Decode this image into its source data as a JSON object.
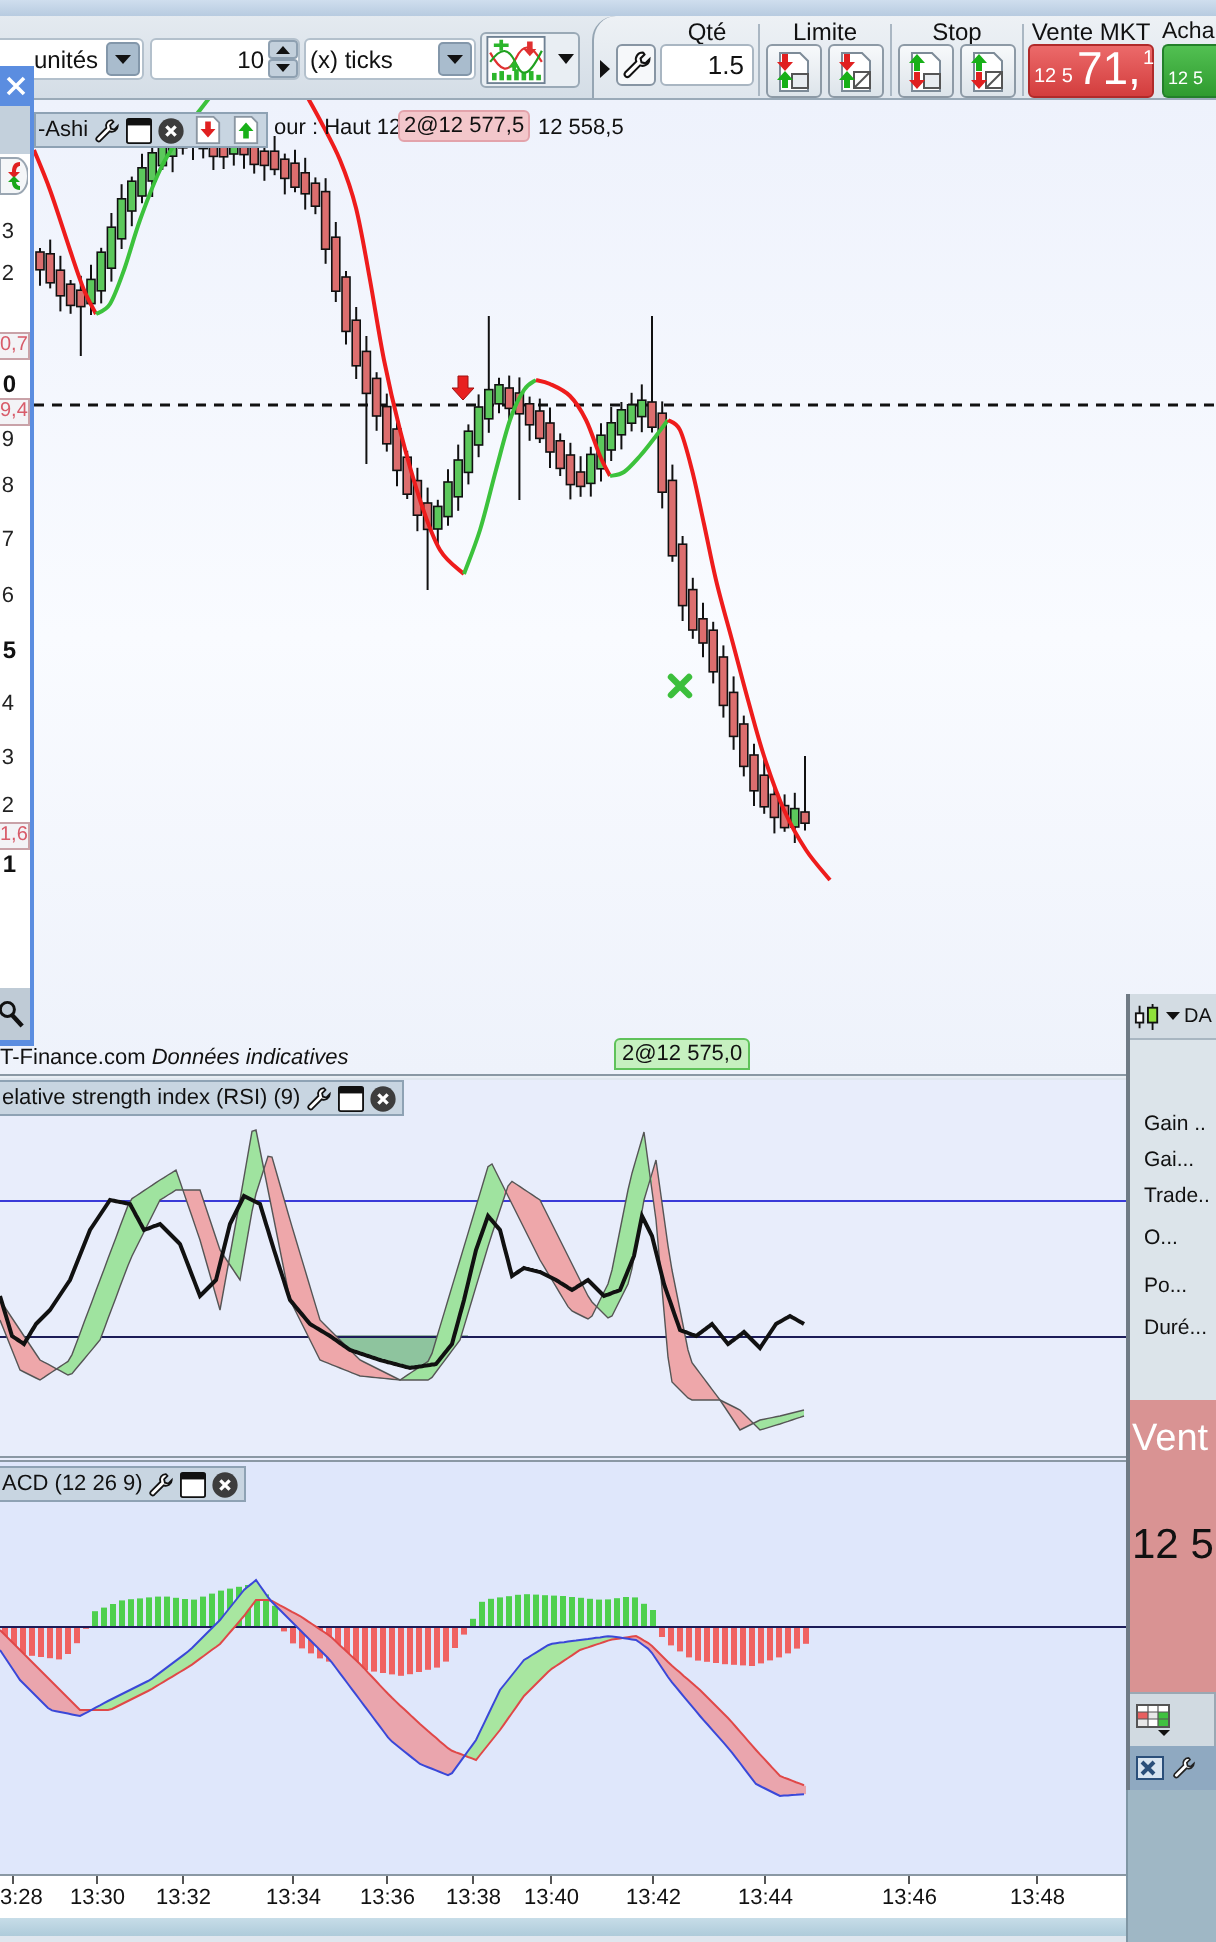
{
  "toolbar": {
    "units_dropdown": {
      "value": "unités"
    },
    "tick_field": {
      "value": "10"
    },
    "tick_unit_dropdown": {
      "value": "(x) ticks"
    },
    "quantity": {
      "label": "Qté",
      "value": "1.5"
    },
    "limit": {
      "label": "Limite"
    },
    "stop": {
      "label": "Stop"
    },
    "sell_market": {
      "label": "Vente MKT",
      "price_prefix": "12 5",
      "price_main": "71,",
      "price_decimal": "1"
    },
    "buy_market": {
      "label": "Acha",
      "price_prefix": "12 5"
    }
  },
  "scale_panel": {
    "price_labels": [
      {
        "text": "3",
        "kind": "plain"
      },
      {
        "text": "2",
        "kind": "plain"
      },
      {
        "text": "0,7",
        "kind": "boxed"
      },
      {
        "text": "0",
        "kind": "bold"
      },
      {
        "text": "9,4",
        "kind": "boxed"
      },
      {
        "text": "9",
        "kind": "plain"
      },
      {
        "text": "8",
        "kind": "plain"
      },
      {
        "text": "7",
        "kind": "plain"
      },
      {
        "text": "6",
        "kind": "plain"
      },
      {
        "text": "5",
        "kind": "bold"
      },
      {
        "text": "4",
        "kind": "plain"
      },
      {
        "text": "3",
        "kind": "plain"
      },
      {
        "text": "2",
        "kind": "plain"
      },
      {
        "text": "1,6",
        "kind": "boxed"
      },
      {
        "text": "1",
        "kind": "bold"
      }
    ]
  },
  "price_chart": {
    "indicator": {
      "name": "-Ashi"
    },
    "header_text": "our : Haut 12",
    "order_badge": "2@12 577,5",
    "header_low": "12 558,5",
    "pending_order_badge": "2@12 575,0",
    "source_note": "T-Finance.com *Données indicatives*"
  },
  "rsi_panel": {
    "title": "elative strength index (RSI) (9)"
  },
  "macd_panel": {
    "title": "ACD (12 26 9)"
  },
  "time_axis": {
    "labels": [
      "3:28",
      "13:30",
      "13:32",
      "13:34",
      "13:36",
      "13:38",
      "13:40",
      "13:42",
      "13:44",
      "13:46",
      "13:48"
    ]
  },
  "trade_panel": {
    "instrument": "DA",
    "stats": [
      "Gain ..",
      "Gai...",
      "Trade..",
      "O...",
      "Po...",
      "Duré..."
    ],
    "quote_label": "Vent",
    "quote_price": "12 5"
  }
}
